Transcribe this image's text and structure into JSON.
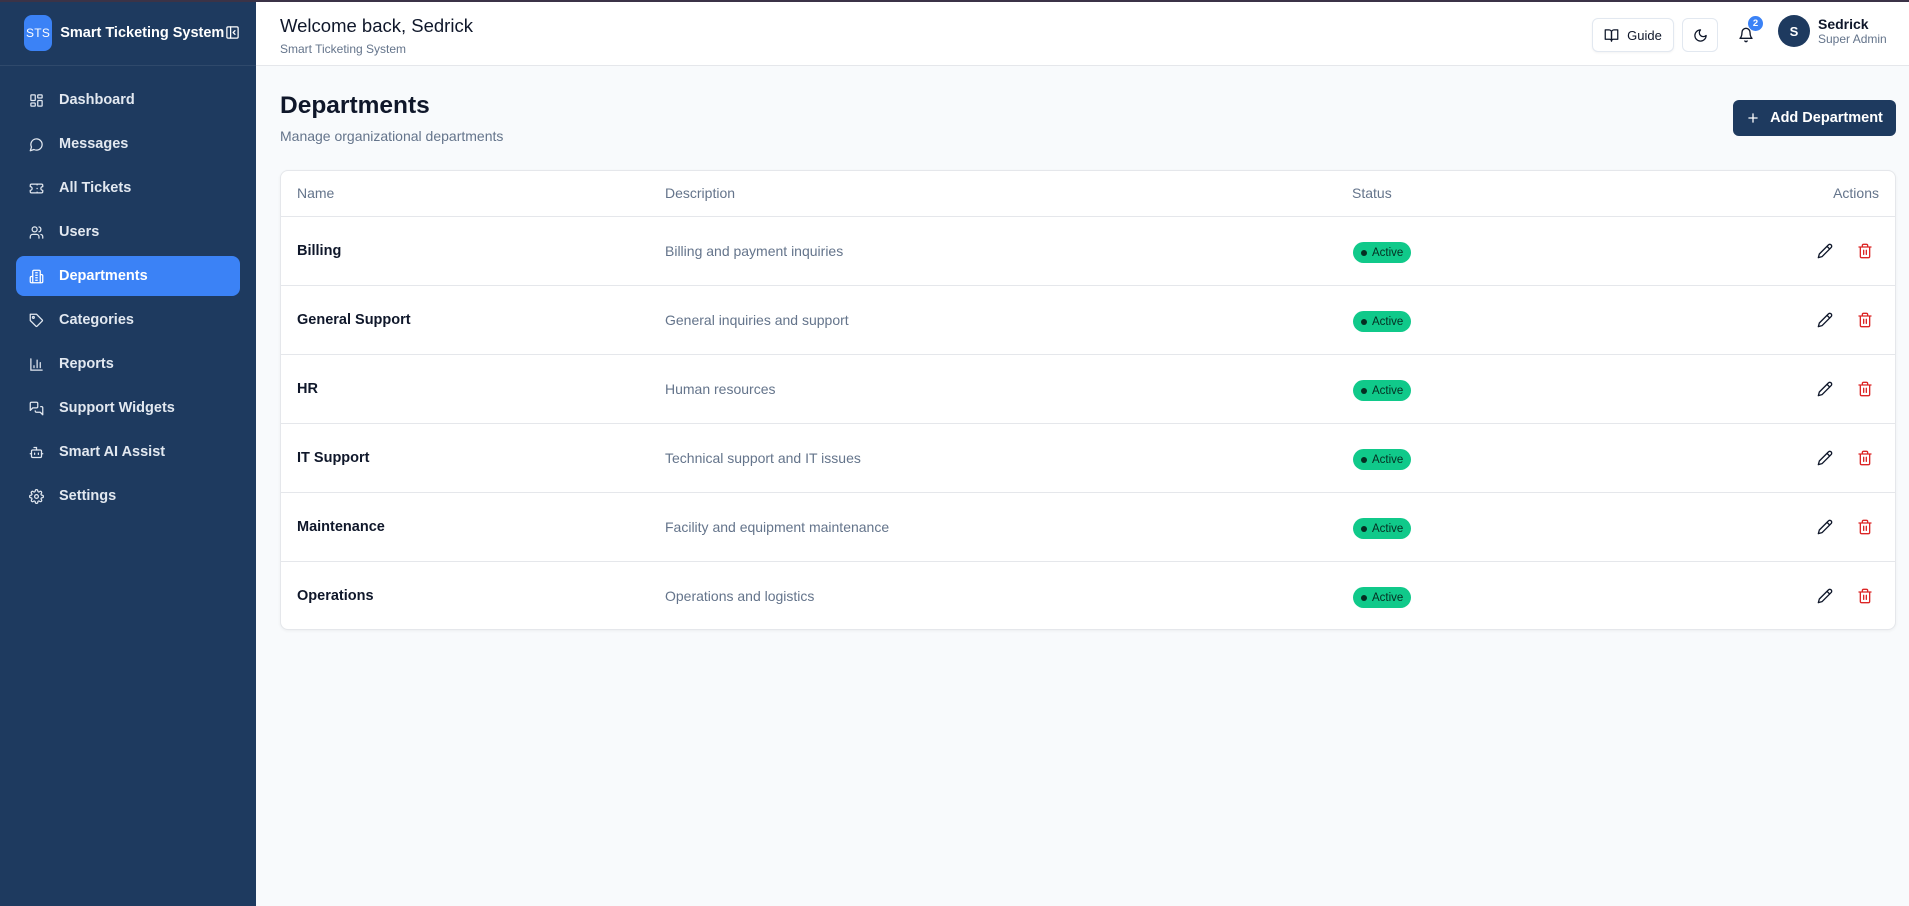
{
  "sidebar": {
    "logo_text": "STS",
    "app_name": "Smart Ticketing System",
    "items": [
      {
        "label": "Dashboard",
        "icon": "dashboard-icon"
      },
      {
        "label": "Messages",
        "icon": "message-icon"
      },
      {
        "label": "All Tickets",
        "icon": "ticket-icon"
      },
      {
        "label": "Users",
        "icon": "users-icon"
      },
      {
        "label": "Departments",
        "icon": "building-icon",
        "active": true
      },
      {
        "label": "Categories",
        "icon": "tag-icon"
      },
      {
        "label": "Reports",
        "icon": "bar-chart-icon"
      },
      {
        "label": "Support Widgets",
        "icon": "chat-widget-icon"
      },
      {
        "label": "Smart AI Assist",
        "icon": "bot-icon"
      },
      {
        "label": "Settings",
        "icon": "gear-icon"
      }
    ]
  },
  "header": {
    "welcome": "Welcome back, Sedrick",
    "subtitle": "Smart Ticketing System",
    "guide_label": "Guide",
    "notification_count": "2",
    "user": {
      "initial": "S",
      "name": "Sedrick",
      "role": "Super Admin"
    }
  },
  "page": {
    "title": "Departments",
    "subtitle": "Manage organizational departments",
    "add_button": "Add Department"
  },
  "table": {
    "columns": {
      "name": "Name",
      "description": "Description",
      "status": "Status",
      "actions": "Actions"
    },
    "rows": [
      {
        "name": "Billing",
        "description": "Billing and payment inquiries",
        "status": "Active"
      },
      {
        "name": "General Support",
        "description": "General inquiries and support",
        "status": "Active"
      },
      {
        "name": "HR",
        "description": "Human resources",
        "status": "Active"
      },
      {
        "name": "IT Support",
        "description": "Technical support and IT issues",
        "status": "Active"
      },
      {
        "name": "Maintenance",
        "description": "Facility and equipment maintenance",
        "status": "Active"
      },
      {
        "name": "Operations",
        "description": "Operations and logistics",
        "status": "Active"
      }
    ]
  },
  "colors": {
    "sidebar_bg": "#1e3a5f",
    "accent": "#3b82f6",
    "status_active": "#10c98a",
    "danger": "#dc2626"
  }
}
